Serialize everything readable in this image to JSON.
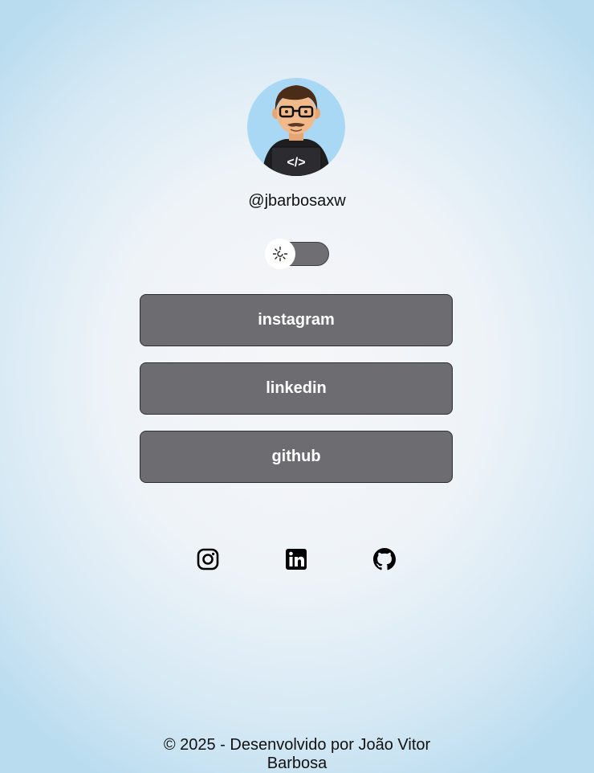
{
  "profile": {
    "username": "@jbarbosaxw",
    "avatar_icon": "developer-avatar-icon"
  },
  "theme_toggle": {
    "icon": "sun-icon",
    "state": "off"
  },
  "links": [
    {
      "label": "instagram"
    },
    {
      "label": "linkedin"
    },
    {
      "label": "github"
    }
  ],
  "social": [
    {
      "icon": "instagram-icon"
    },
    {
      "icon": "linkedin-icon"
    },
    {
      "icon": "github-icon"
    }
  ],
  "footer": {
    "text": "© 2025 - Desenvolvido por João Vitor Barbosa"
  },
  "colors": {
    "button_bg": "#6d6c71",
    "button_text": "#ffffff",
    "avatar_bg": "#a9d8f5",
    "background_center": "#f6f6f8",
    "background_edge": "#b9dcef"
  }
}
